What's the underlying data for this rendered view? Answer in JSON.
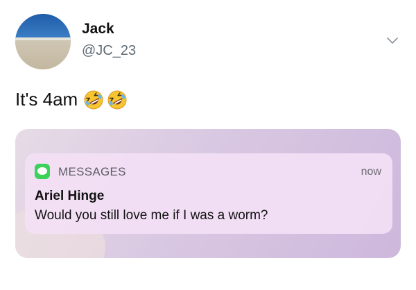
{
  "tweet": {
    "author": {
      "display_name": "Jack",
      "handle": "@JC_23",
      "avatar": "beach-photo"
    },
    "text": "It's 4am",
    "emojis": [
      "rolling-on-floor-laughing-emoji",
      "rolling-on-floor-laughing-emoji"
    ],
    "menu_icon": "chevron-down-icon"
  },
  "notification": {
    "app_icon": "messages-app-icon",
    "app_name": "MESSAGES",
    "timestamp": "now",
    "sender": "Ariel Hinge",
    "message": "Would you still love me if I was a worm?"
  },
  "colors": {
    "messages_green": "#3bd25a",
    "handle_gray": "#5f6b76"
  }
}
